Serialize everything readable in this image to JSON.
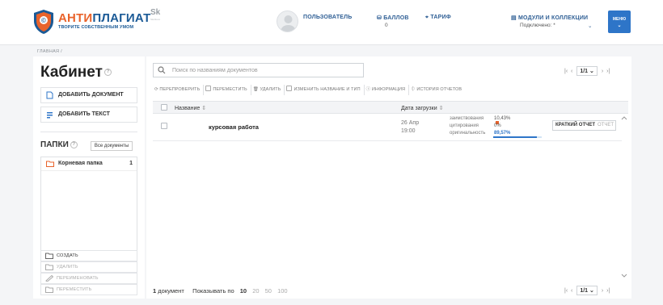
{
  "header": {
    "logo": {
      "part1": "АНТИ",
      "part2": "ПЛАГИАТ",
      "slogan": "ТВОРИТЕ СОБСТВЕННЫМ УМОМ"
    },
    "partner_logo": {
      "text": "Sk",
      "sub": "Skolkovo"
    },
    "user_label": "ПОЛЬЗОВАТЕЛЬ",
    "points_label": "БАЛЛОВ",
    "points_value": "0",
    "tariff_label": "ТАРИФ",
    "modules_label": "МОДУЛИ И КОЛЛЕКЦИИ",
    "modules_status": "Подключено: *",
    "menu_label": "МЕНЮ",
    "icons": [
      "shield-logo",
      "avatar",
      "database-icon",
      "tag-icon",
      "document-icon",
      "chevron-down-icon"
    ]
  },
  "breadcrumb": {
    "home": "ГЛАВНАЯ",
    "separator": "/"
  },
  "sidebar": {
    "title": "Кабинет",
    "help_glyph": "?",
    "add_document": "ДОБАВИТЬ ДОКУМЕНТ",
    "add_text": "ДОБАВИТЬ ТЕКСТ",
    "folders_title": "ПАПКИ",
    "all_docs": "Все документы",
    "folders": [
      {
        "name": "Корневая папка",
        "count": "1"
      }
    ],
    "actions": [
      {
        "label": "СОЗДАТЬ",
        "enabled": true
      },
      {
        "label": "УДАЛИТЬ",
        "enabled": false
      },
      {
        "label": "ПЕРЕИМЕНОВАТЬ",
        "enabled": false
      },
      {
        "label": "ПЕРЕМЕСТИТЬ",
        "enabled": false
      }
    ]
  },
  "main": {
    "search_placeholder": "Поиск по названиям документов",
    "pagination": {
      "current": "1/1"
    },
    "toolbar": {
      "recheck": "ПЕРЕПРОВЕРИТЬ",
      "move": "ПЕРЕМЕСТИТЬ",
      "delete": "УДАЛИТЬ",
      "rename": "ИЗМЕНИТЬ НАЗВАНИЕ И ТИП",
      "info": "ИНФОРМАЦИЯ",
      "history": "ИСТОРИЯ ОТЧЕТОВ"
    },
    "table": {
      "col_name": "Название",
      "col_date": "Дата загрузки",
      "sort_glyph": "⇕",
      "rows": [
        {
          "title": "курсовая работа",
          "date_line1": "26 Апр",
          "date_line2": "19:00",
          "borrowing_label": "заимствования",
          "borrowing_value": "10,43%",
          "citation_label": "цитирования",
          "citation_value": "0%",
          "originality_label": "оригинальность",
          "originality_value": "89,57%",
          "originality_fraction": 0.8957,
          "short_report": "КРАТКИЙ ОТЧЕТ",
          "report": "ОТЧЕТ"
        }
      ]
    },
    "footer": {
      "doc_count": "1",
      "doc_word": "документ",
      "show_by": "Показывать по",
      "page_sizes": [
        "10",
        "20",
        "50",
        "100"
      ],
      "active_page_size": "10"
    }
  },
  "colors": {
    "accent_orange": "#e9632b",
    "brand_blue": "#1b5a96",
    "link_blue": "#2f5f95",
    "menu_blue": "#2e75c8"
  }
}
